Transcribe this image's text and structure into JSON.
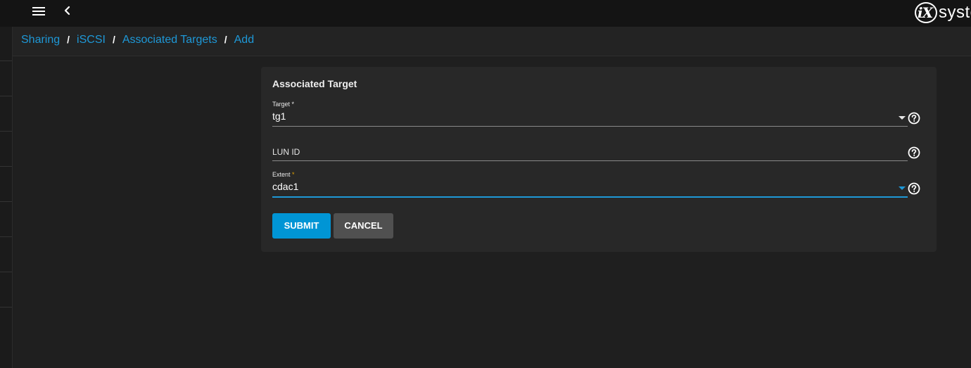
{
  "brand": {
    "logo_mark": "iX",
    "logo_text": "systems"
  },
  "topbar": {
    "menu_icon": "hamburger-menu-icon",
    "back_icon": "chevron-left-icon"
  },
  "breadcrumb": {
    "items": [
      "Sharing",
      "iSCSI",
      "Associated Targets",
      "Add"
    ],
    "separator": "/"
  },
  "form": {
    "title": "Associated Target",
    "fields": {
      "target": {
        "label": "Target",
        "required_mark": "*",
        "value": "tg1"
      },
      "lun_id": {
        "label": "LUN ID",
        "value": ""
      },
      "extent": {
        "label": "Extent",
        "required_mark": "*",
        "value": "cdac1"
      }
    },
    "buttons": {
      "submit": "SUBMIT",
      "cancel": "CANCEL"
    }
  },
  "colors": {
    "accent": "#0095d5",
    "link": "#1e98d7",
    "background": "#1f1f1f",
    "card": "#282828",
    "topbar": "#141414"
  }
}
